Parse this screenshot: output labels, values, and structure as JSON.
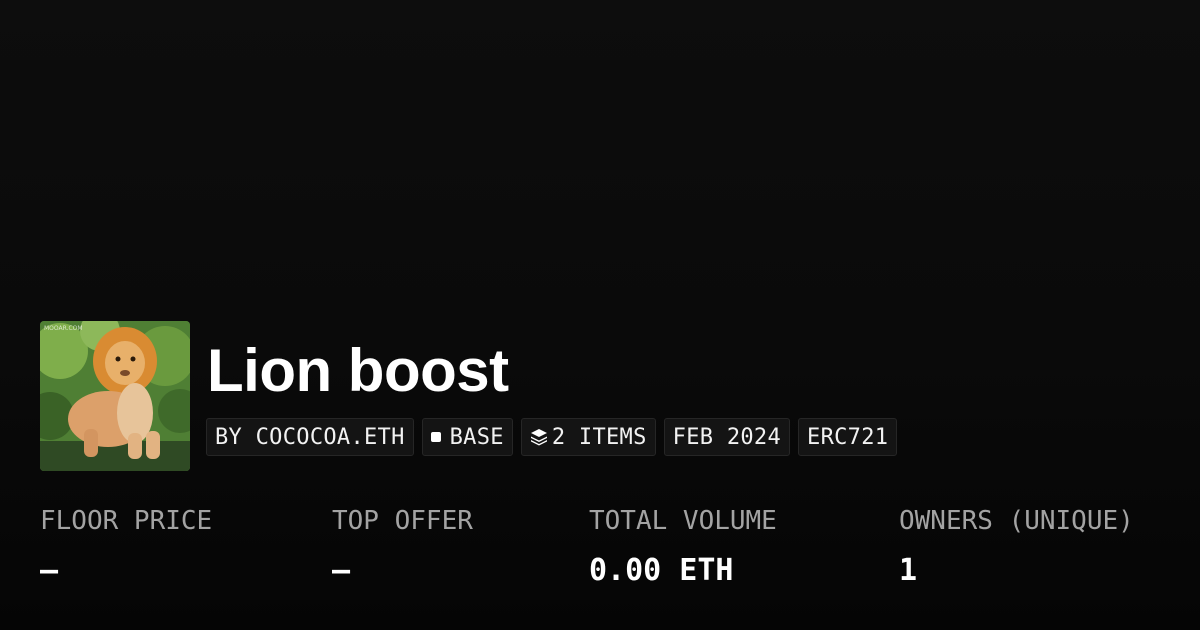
{
  "collection": {
    "title": "Lion boost",
    "thumbnail_icon": "lion-artwork",
    "thumbnail_watermark": "MOOAR.COM"
  },
  "tags": {
    "creator": "BY COCOCOA.ETH",
    "chain": "BASE",
    "items": "2 ITEMS",
    "date": "FEB 2024",
    "standard": "ERC721"
  },
  "stats": [
    {
      "label": "FLOOR PRICE",
      "value": "–"
    },
    {
      "label": "TOP OFFER",
      "value": "–"
    },
    {
      "label": "TOTAL VOLUME",
      "value": "0.00 ETH"
    },
    {
      "label": "OWNERS (UNIQUE)",
      "value": "1"
    }
  ]
}
